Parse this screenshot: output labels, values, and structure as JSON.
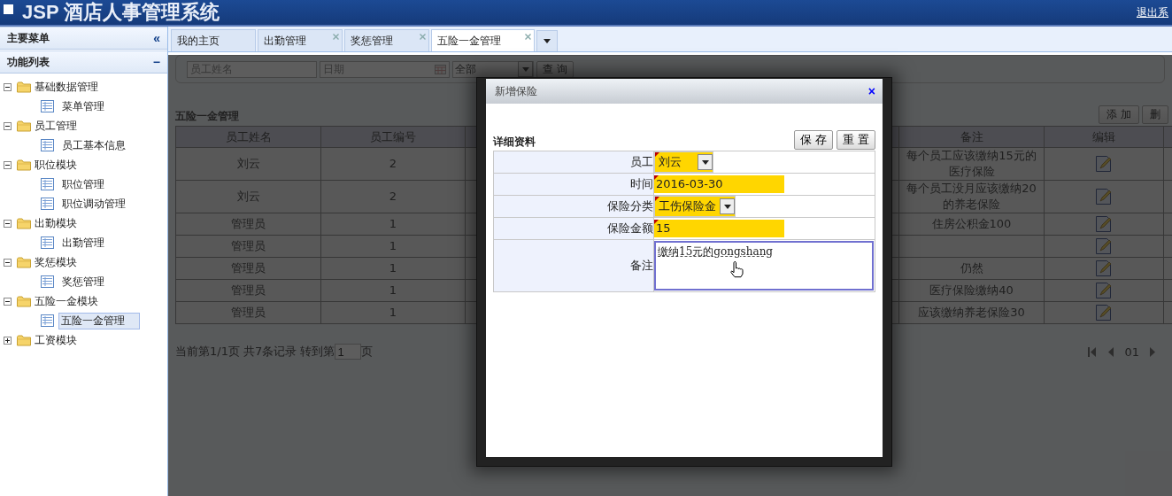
{
  "header": {
    "title": "JSP 酒店人事管理系统",
    "logout": "退出系"
  },
  "sidebar": {
    "title": "主要菜单",
    "collapse": "«",
    "section": "功能列表",
    "section_toggle": "−",
    "tree": [
      {
        "label": "基础数据管理",
        "expanded": true,
        "children": [
          {
            "label": "菜单管理",
            "selected": false
          }
        ]
      },
      {
        "label": "员工管理",
        "expanded": true,
        "children": [
          {
            "label": "员工基本信息",
            "selected": false
          }
        ]
      },
      {
        "label": "职位模块",
        "expanded": true,
        "children": [
          {
            "label": "职位管理",
            "selected": false
          },
          {
            "label": "职位调动管理",
            "selected": false
          }
        ]
      },
      {
        "label": "出勤模块",
        "expanded": true,
        "children": [
          {
            "label": "出勤管理",
            "selected": false
          }
        ]
      },
      {
        "label": "奖惩模块",
        "expanded": true,
        "children": [
          {
            "label": "奖惩管理",
            "selected": false
          }
        ]
      },
      {
        "label": "五险一金模块",
        "expanded": true,
        "children": [
          {
            "label": "五险一金管理",
            "selected": true
          }
        ]
      },
      {
        "label": "工资模块",
        "expanded": false
      }
    ]
  },
  "tabs": [
    {
      "label": "我的主页",
      "closable": false,
      "selected": false
    },
    {
      "label": "出勤管理",
      "closable": true,
      "selected": false
    },
    {
      "label": "奖惩管理",
      "closable": true,
      "selected": false
    },
    {
      "label": "五险一金管理",
      "closable": true,
      "selected": true
    }
  ],
  "filters": {
    "name_placeholder": "员工姓名",
    "date_placeholder": "日期",
    "type_value": "全部",
    "search": "查 询"
  },
  "section_title": "五险一金管理",
  "actions": [
    "添 加",
    "删"
  ],
  "table": {
    "columns": [
      "员工姓名",
      "员工编号",
      "备注",
      "编辑"
    ],
    "rows": [
      {
        "name": "刘云",
        "id": "2",
        "note": "每个员工应该缴纳15元的医疗保险"
      },
      {
        "name": "刘云",
        "id": "2",
        "note": "每个员工没月应该缴纳20的养老保险"
      },
      {
        "name": "管理员",
        "id": "1",
        "note": "住房公积金100"
      },
      {
        "name": "管理员",
        "id": "1",
        "note": ""
      },
      {
        "name": "管理员",
        "id": "1",
        "note": "仍然"
      },
      {
        "name": "管理员",
        "id": "1",
        "note": "医疗保险缴纳40"
      },
      {
        "name": "管理员",
        "id": "1",
        "note": "应该缴纳养老保险30"
      }
    ]
  },
  "pager": {
    "before": "当前第1/1页 共7条记录 转到第",
    "page_input": "1",
    "after": "页",
    "page": "01"
  },
  "dialog": {
    "title": "新增保险",
    "close": "×",
    "section": "详细资料",
    "buttons": [
      "保 存",
      "重 置"
    ],
    "fields": [
      {
        "label": "员工",
        "kind": "select",
        "value": "刘云",
        "required": true
      },
      {
        "label": "时间",
        "kind": "text",
        "value": "2016-03-30",
        "required": true
      },
      {
        "label": "保险分类",
        "kind": "select",
        "value": "工伤保险金",
        "required": true
      },
      {
        "label": "保险金额",
        "kind": "text",
        "value": "15",
        "required": true
      },
      {
        "label": "备注",
        "kind": "textarea",
        "value": "缴纳15元的gongshang",
        "required": false
      }
    ]
  }
}
